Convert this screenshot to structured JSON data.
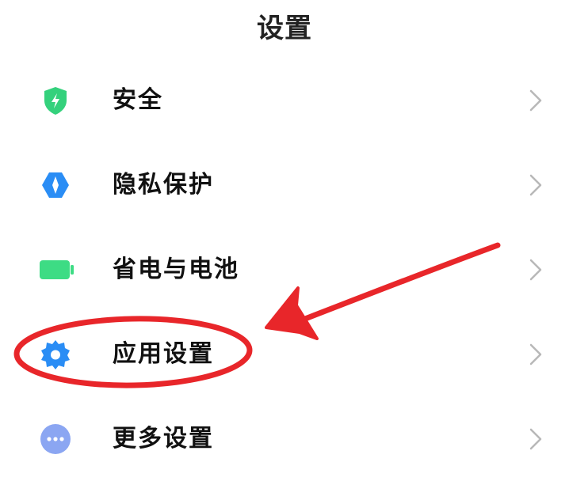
{
  "header": {
    "title": "设置"
  },
  "settings_items": [
    {
      "label": "安全",
      "icon": "security-shield-icon",
      "icon_color": "#34d17c"
    },
    {
      "label": "隐私保护",
      "icon": "privacy-icon",
      "icon_color": "#2a8df5"
    },
    {
      "label": "省电与电池",
      "icon": "battery-icon",
      "icon_color": "#3ddc84"
    },
    {
      "label": "应用设置",
      "icon": "gear-icon",
      "icon_color": "#2a8df5"
    },
    {
      "label": "更多设置",
      "icon": "more-dots-icon",
      "icon_color": "#8ba6f2"
    }
  ],
  "annotation": {
    "color": "#e8262a",
    "highlighted_item": "应用设置"
  }
}
